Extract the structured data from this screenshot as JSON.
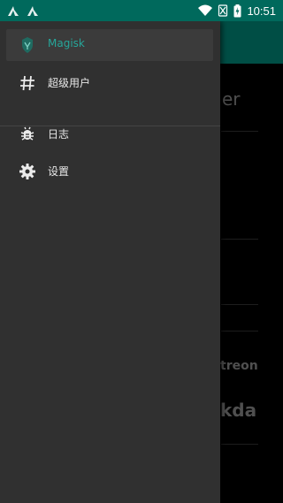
{
  "status_bar": {
    "time": "10:51"
  },
  "background_app": {
    "fragment_1": "er",
    "fragment_2": "treon",
    "fragment_3": "kda"
  },
  "drawer": {
    "items": [
      {
        "label": "Magisk",
        "icon": "magisk-icon",
        "active": true
      },
      {
        "label": "超级用户",
        "icon": "hash-icon",
        "active": false
      },
      {
        "label": "日志",
        "icon": "bug-icon",
        "active": false
      },
      {
        "label": "设置",
        "icon": "gear-icon",
        "active": false
      }
    ]
  },
  "colors": {
    "status_bar": "#00695c",
    "toolbar": "#00796b",
    "accent": "#26a69a",
    "drawer_bg": "#303030"
  }
}
